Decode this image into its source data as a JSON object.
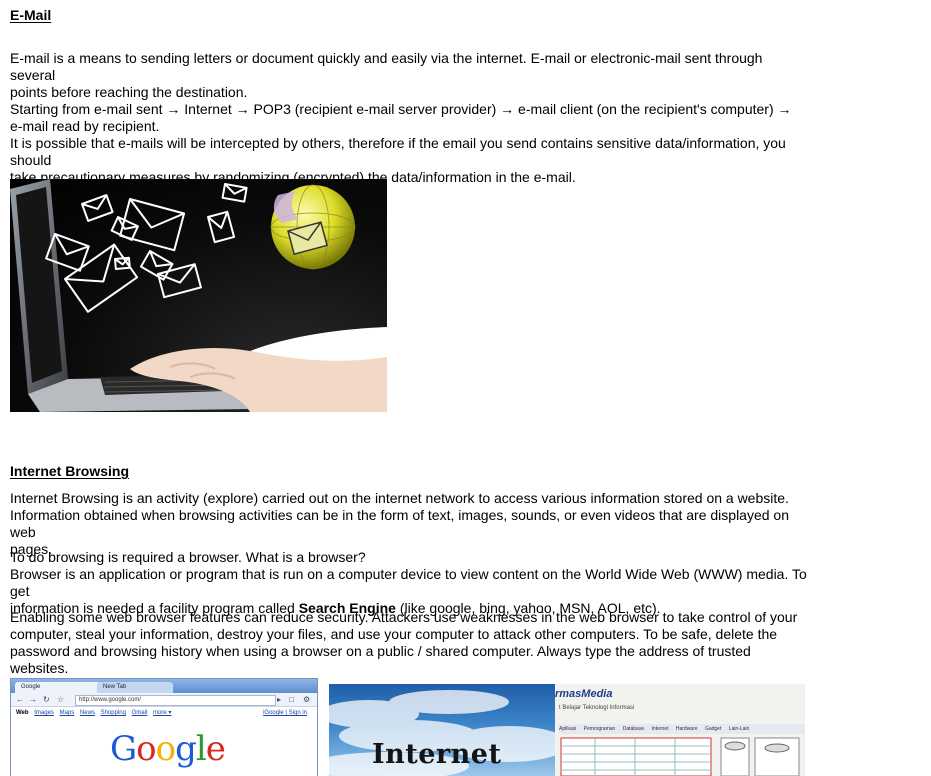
{
  "email": {
    "heading": "E-Mail",
    "paragraph": [
      "E-mail is a means to sending letters or document quickly and easily via the internet. E-mail or electronic-mail sent through several",
      "points before reaching the destination.",
      "Starting from e-mail sent → Internet → POP3 (recipient e-mail server provider) → e-mail client (on the recipient's computer) →",
      "e-mail read by recipient.",
      "It is possible that e-mails will be intercepted by others, therefore if the email you send contains sensitive data/information, you should",
      "take precautionary measures by randomizing (encrypted) the data/information in the e-mail."
    ]
  },
  "browsing": {
    "heading": "Internet Browsing",
    "paragraph1": [
      "Internet Browsing is an activity (explore) carried out on the internet network to access various information stored on a website.",
      "Information obtained when browsing activities can be in the form of text, images, sounds, or even videos that are displayed on web",
      "pages."
    ],
    "paragraph2": {
      "line1": "To do browsing is required a browser. What is a browser?",
      "line2": "Browser is an application or program that is run on a computer device to view content on the World Wide Web (WWW) media. To get",
      "line3_pre": "information is needed a facility program called ",
      "line3_bold": "Search Engine",
      "line3_post": " (like google, bing, yahoo, MSN, AOL, etc)."
    },
    "paragraph3": [
      "Enabling some web browser features can reduce security. Attackers use weaknesses in the web browser to take control of your",
      "computer, steal your information, destroy your files, and use your computer to attack other computers. To be safe, delete the",
      "password and browsing history when using a browser on a public / shared computer. Always type the address of trusted websites."
    ]
  },
  "browser_screenshot": {
    "tab1": "Google",
    "tab2": "New Tab",
    "address": "http://www.google.com/",
    "links": [
      "Web",
      "Images",
      "Maps",
      "News",
      "Shopping",
      "Gmail",
      "more ▾"
    ],
    "signin": "iGoogle | Sign in",
    "logo_letters": [
      "G",
      "o",
      "o",
      "g",
      "l",
      "e"
    ],
    "logo_colors": [
      "#1a5bd8",
      "#d52a1c",
      "#f2b400",
      "#1a5bd8",
      "#2a9a35",
      "#d52a1c"
    ]
  },
  "internet_graphic": {
    "word": "Internet",
    "brand": "rmasMedia",
    "brand_sub": "t Belajar Teknologi Informasi",
    "menu": [
      "Aplikasi",
      "Pemrograman",
      "Database",
      "Internet",
      "Hardware",
      "Gadget",
      "Lain-Lain"
    ]
  }
}
